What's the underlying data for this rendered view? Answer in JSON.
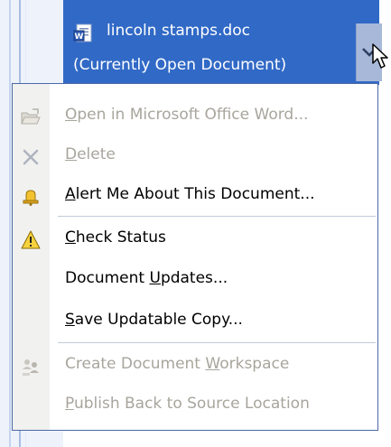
{
  "header": {
    "file_name": "lincoln stamps.doc",
    "status": "(Currently Open Document)"
  },
  "menu": {
    "items": [
      {
        "pre": "",
        "key": "O",
        "post": "pen in Microsoft Office Word...",
        "enabled": false,
        "icon": "open-folder-icon"
      },
      {
        "pre": "",
        "key": "D",
        "post": "elete",
        "enabled": false,
        "icon": "delete-x-icon"
      },
      {
        "pre": "",
        "key": "A",
        "post": "lert Me About This Document...",
        "enabled": true,
        "icon": "bell-icon"
      },
      {
        "pre": "",
        "key": "C",
        "post": "heck Status",
        "enabled": true,
        "icon": "warning-icon"
      },
      {
        "pre": "Document ",
        "key": "U",
        "post": "pdates...",
        "enabled": true,
        "icon": ""
      },
      {
        "pre": "",
        "key": "S",
        "post": "ave Updatable Copy...",
        "enabled": true,
        "icon": ""
      },
      {
        "pre": "Create Document ",
        "key": "W",
        "post": "orkspace",
        "enabled": false,
        "icon": "workspace-people-icon"
      },
      {
        "pre": "",
        "key": "P",
        "post": "ublish Back to Source Location",
        "enabled": false,
        "icon": ""
      }
    ]
  },
  "colors": {
    "selection": "#3169c6",
    "disabled_text": "#a8a59d",
    "menu_border": "#4c69a6"
  }
}
